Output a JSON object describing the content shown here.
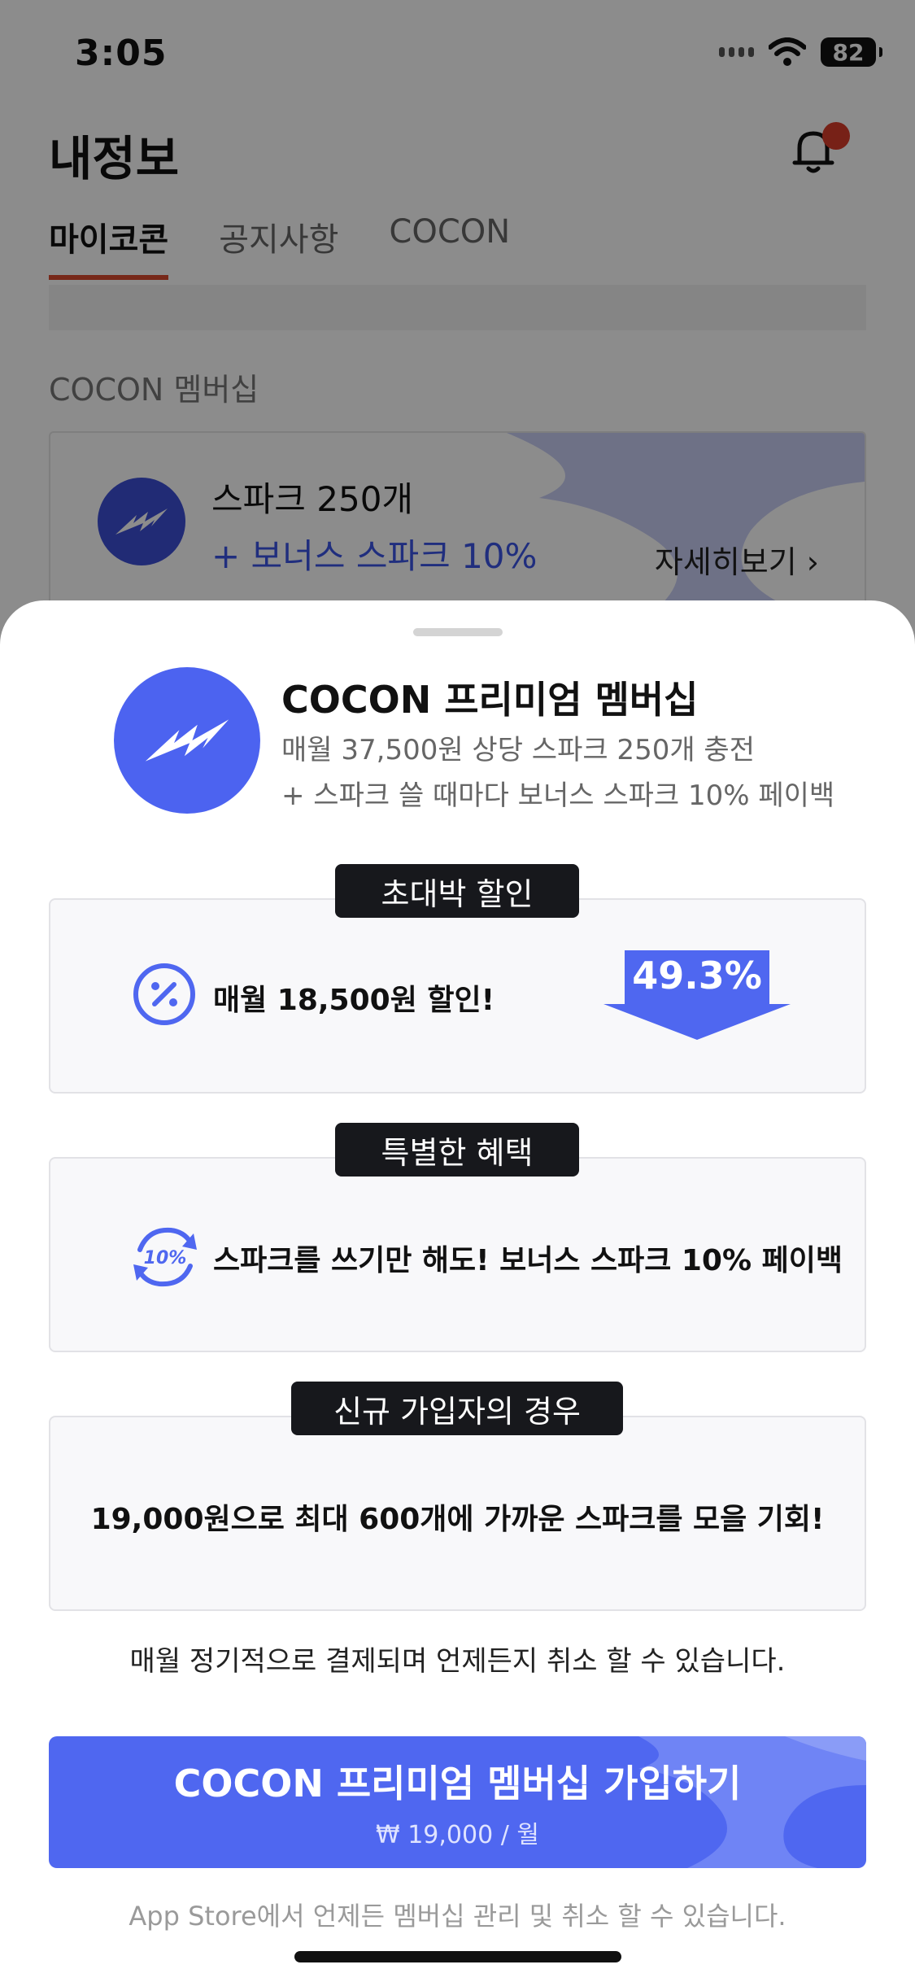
{
  "status_bar": {
    "time": "3:05",
    "battery": "82"
  },
  "header": {
    "title": "내정보"
  },
  "tabs": [
    {
      "label": "마이코콘",
      "active": true
    },
    {
      "label": "공지사항",
      "active": false
    },
    {
      "label": "COCON",
      "active": false
    }
  ],
  "membership_section": {
    "label": "COCON 멤버십",
    "card": {
      "name": "스파크 250개",
      "bonus": "+ 보너스 스파크 10%",
      "more": "자세히보기 ›"
    }
  },
  "sheet": {
    "title": "COCON 프리미엄 멤버십",
    "desc1": "매월 37,500원 상당 스파크 250개 충전",
    "desc2": "+ 스파크 쓸 때마다 보너스 스파크 10% 페이백",
    "discount": {
      "tag": "초대박 할인",
      "text": "매월 18,500원 할인!",
      "percent": "49.3%"
    },
    "benefit": {
      "tag": "특별한 혜택",
      "text": "스파크를 쓰기만 해도! 보너스 스파크 10% 페이백",
      "icon_text": "10%"
    },
    "newcomer": {
      "tag": "신규 가입자의 경우",
      "text": "19,000원으로  최대 600개에 가까운 스파크를 모을 기회!"
    },
    "note": "매월 정기적으로 결제되며 언제든지 취소 할 수 있습니다.",
    "cta": {
      "title": "COCON 프리미엄 멤버십 가입하기",
      "price": "₩ 19,000 / 월"
    },
    "footer": "App Store에서 언제든 멤버십 관리 및 취소 할 수 있습니다."
  },
  "colors": {
    "brand": "#4f67f0",
    "accent_red": "#d94a2e",
    "tag_bg": "#17181c"
  },
  "icons": [
    "wifi-icon",
    "bell-icon",
    "spark-logo-icon",
    "percent-icon",
    "cycle-10-icon",
    "down-arrow-icon"
  ]
}
